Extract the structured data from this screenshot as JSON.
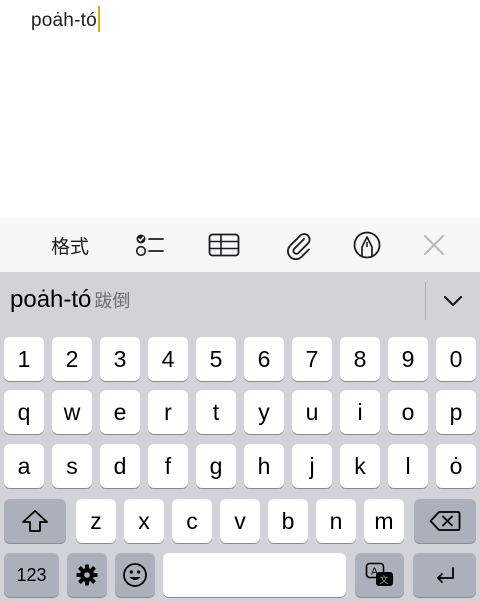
{
  "note": {
    "text": "poȧh-tó"
  },
  "toolbar": {
    "format_label": "格式",
    "checklist_icon": "checklist-icon",
    "table_icon": "table-icon",
    "attach_icon": "paperclip-icon",
    "markup_icon": "pen-markup-icon",
    "close_icon": "close-icon"
  },
  "keyboard": {
    "candidate": {
      "romanization": "poȧh-tó",
      "hanzi": "跋倒"
    },
    "rows": {
      "numbers": [
        "1",
        "2",
        "3",
        "4",
        "5",
        "6",
        "7",
        "8",
        "9",
        "0"
      ],
      "row1": [
        "q",
        "w",
        "e",
        "r",
        "t",
        "y",
        "u",
        "i",
        "o",
        "p"
      ],
      "row2": [
        "a",
        "s",
        "d",
        "f",
        "g",
        "h",
        "j",
        "k",
        "l",
        "ȯ"
      ],
      "row3": [
        "z",
        "x",
        "c",
        "v",
        "b",
        "n",
        "m"
      ]
    },
    "mode_label": "123"
  }
}
